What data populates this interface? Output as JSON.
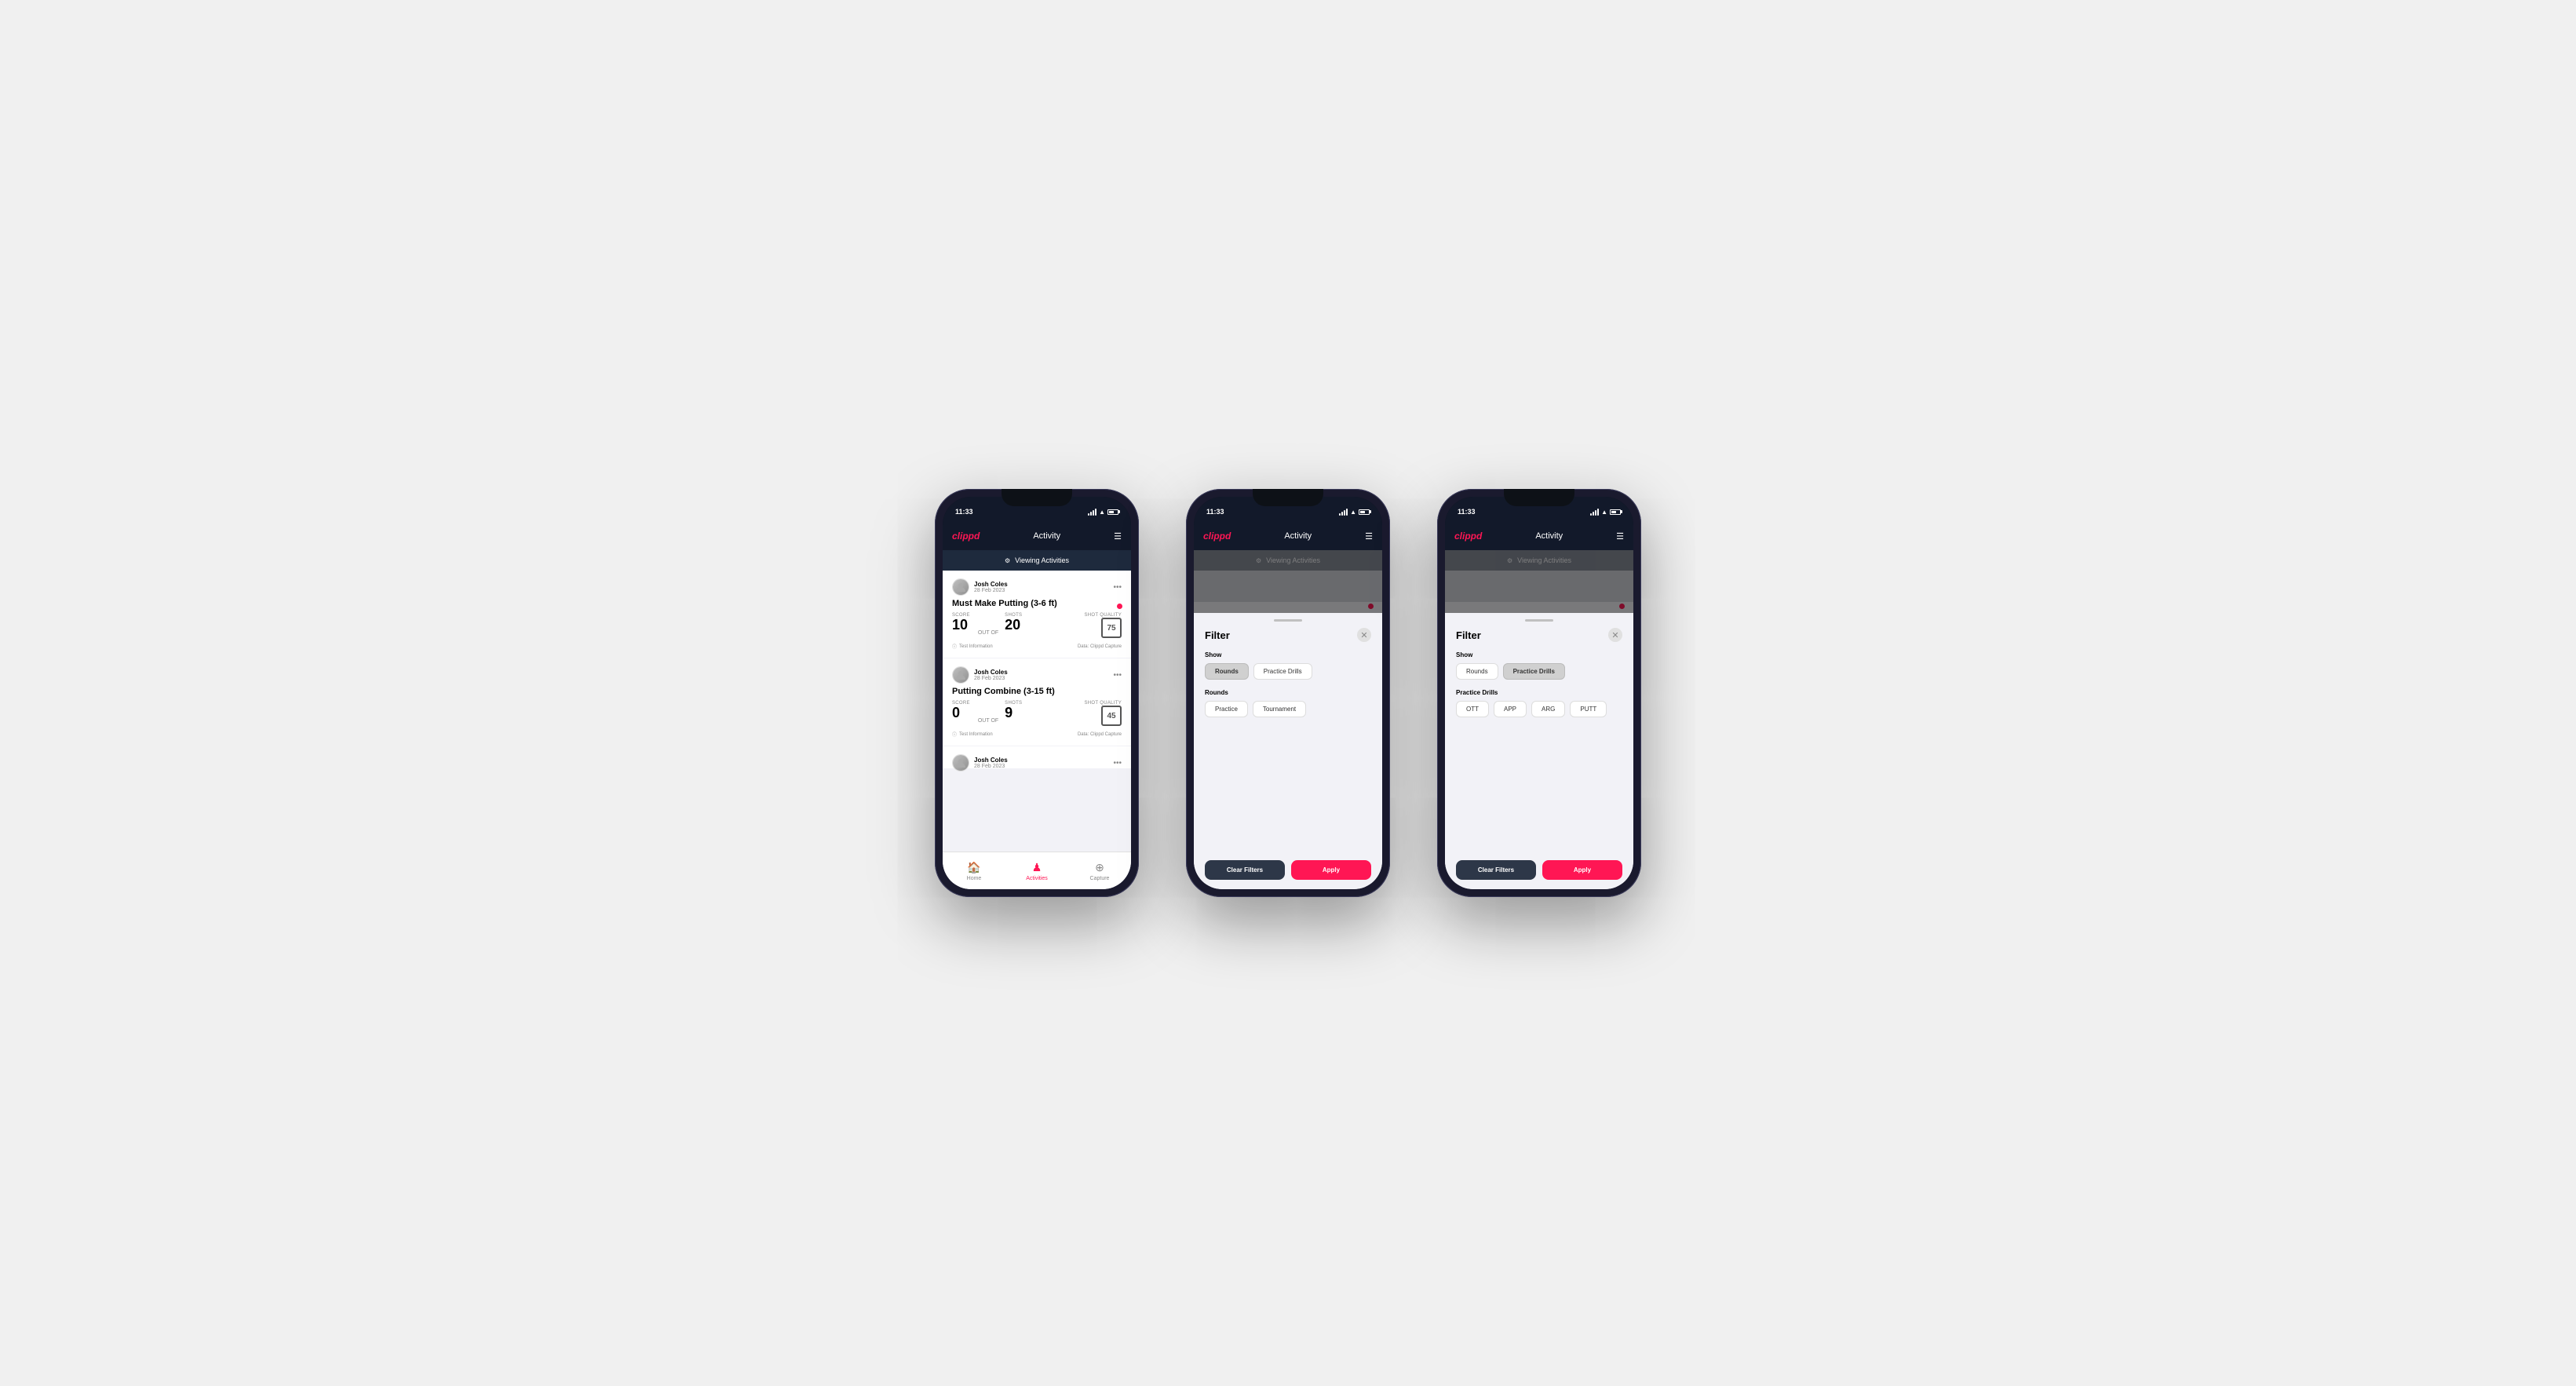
{
  "app": {
    "name": "clippd",
    "screen_title": "Activity",
    "status_time": "11:33"
  },
  "phone1": {
    "viewing_banner": "Viewing Activities",
    "activities": [
      {
        "user_name": "Josh Coles",
        "user_date": "28 Feb 2023",
        "title": "Must Make Putting (3-6 ft)",
        "score_label": "Score",
        "score_value": "10",
        "shots_label": "Shots",
        "out_of": "OUT OF",
        "shots_value": "20",
        "shot_quality_label": "Shot Quality",
        "shot_quality_value": "75",
        "info": "Test Information",
        "data_source": "Data: Clippd Capture"
      },
      {
        "user_name": "Josh Coles",
        "user_date": "28 Feb 2023",
        "title": "Putting Combine (3-15 ft)",
        "score_label": "Score",
        "score_value": "0",
        "shots_label": "Shots",
        "out_of": "OUT OF",
        "shots_value": "9",
        "shot_quality_label": "Shot Quality",
        "shot_quality_value": "45",
        "info": "Test Information",
        "data_source": "Data: Clippd Capture"
      },
      {
        "user_name": "Josh Coles",
        "user_date": "28 Feb 2023",
        "title": "",
        "score_label": "",
        "score_value": "",
        "shots_label": "",
        "out_of": "",
        "shots_value": "",
        "shot_quality_label": "",
        "shot_quality_value": "",
        "info": "",
        "data_source": ""
      }
    ],
    "bottom_nav": {
      "home": "Home",
      "activities": "Activities",
      "capture": "Capture"
    }
  },
  "phone2": {
    "viewing_banner": "Viewing Activities",
    "filter_title": "Filter",
    "show_label": "Show",
    "rounds_btn": "Rounds",
    "practice_drills_btn": "Practice Drills",
    "rounds_section": "Rounds",
    "practice_btn": "Practice",
    "tournament_btn": "Tournament",
    "clear_filters": "Clear Filters",
    "apply": "Apply",
    "active_tab": "rounds"
  },
  "phone3": {
    "viewing_banner": "Viewing Activities",
    "filter_title": "Filter",
    "show_label": "Show",
    "rounds_btn": "Rounds",
    "practice_drills_btn": "Practice Drills",
    "practice_drills_section": "Practice Drills",
    "ott_btn": "OTT",
    "app_btn": "APP",
    "arg_btn": "ARG",
    "putt_btn": "PUTT",
    "clear_filters": "Clear Filters",
    "apply": "Apply",
    "active_tab": "practice_drills"
  }
}
